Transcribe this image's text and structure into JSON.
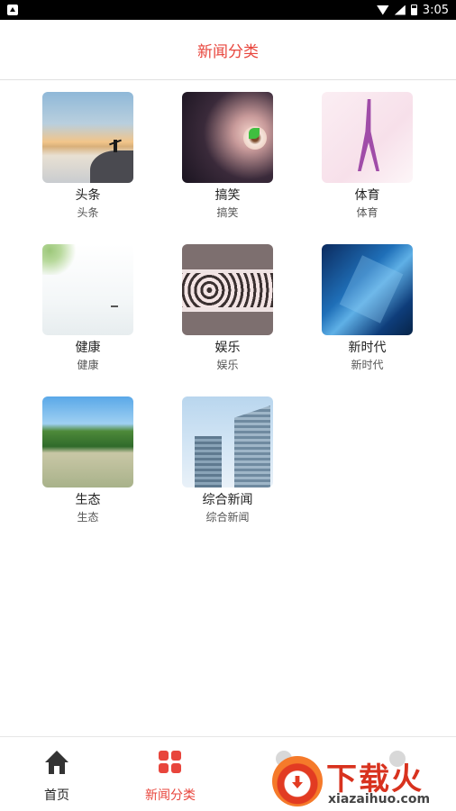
{
  "status_bar": {
    "time": "3:05"
  },
  "header": {
    "title": "新闻分类"
  },
  "categories": [
    {
      "name": "头条",
      "subtitle": "头条",
      "image": "mountain-sunrise"
    },
    {
      "name": "搞笑",
      "subtitle": "搞笑",
      "image": "flower-collage"
    },
    {
      "name": "体育",
      "subtitle": "体育",
      "image": "yoga-figure"
    },
    {
      "name": "健康",
      "subtitle": "健康",
      "image": "misty-lake"
    },
    {
      "name": "娱乐",
      "subtitle": "娱乐",
      "image": "vintage-floral"
    },
    {
      "name": "新时代",
      "subtitle": "新时代",
      "image": "blue-abstract"
    },
    {
      "name": "生态",
      "subtitle": "生态",
      "image": "forest-lake"
    },
    {
      "name": "综合新闻",
      "subtitle": "综合新闻",
      "image": "skyscrapers"
    }
  ],
  "tabbar": {
    "tabs": [
      {
        "label": "首页",
        "icon": "home-icon",
        "active": false
      },
      {
        "label": "新闻分类",
        "icon": "grid-icon",
        "active": true
      },
      {
        "label": "",
        "icon": "unknown-icon",
        "active": false
      },
      {
        "label": "",
        "icon": "unknown-icon",
        "active": false
      }
    ]
  },
  "watermark": {
    "brand": "下载火",
    "domain": "xiazaihuo.com"
  },
  "colors": {
    "accent": "#e8453c"
  }
}
